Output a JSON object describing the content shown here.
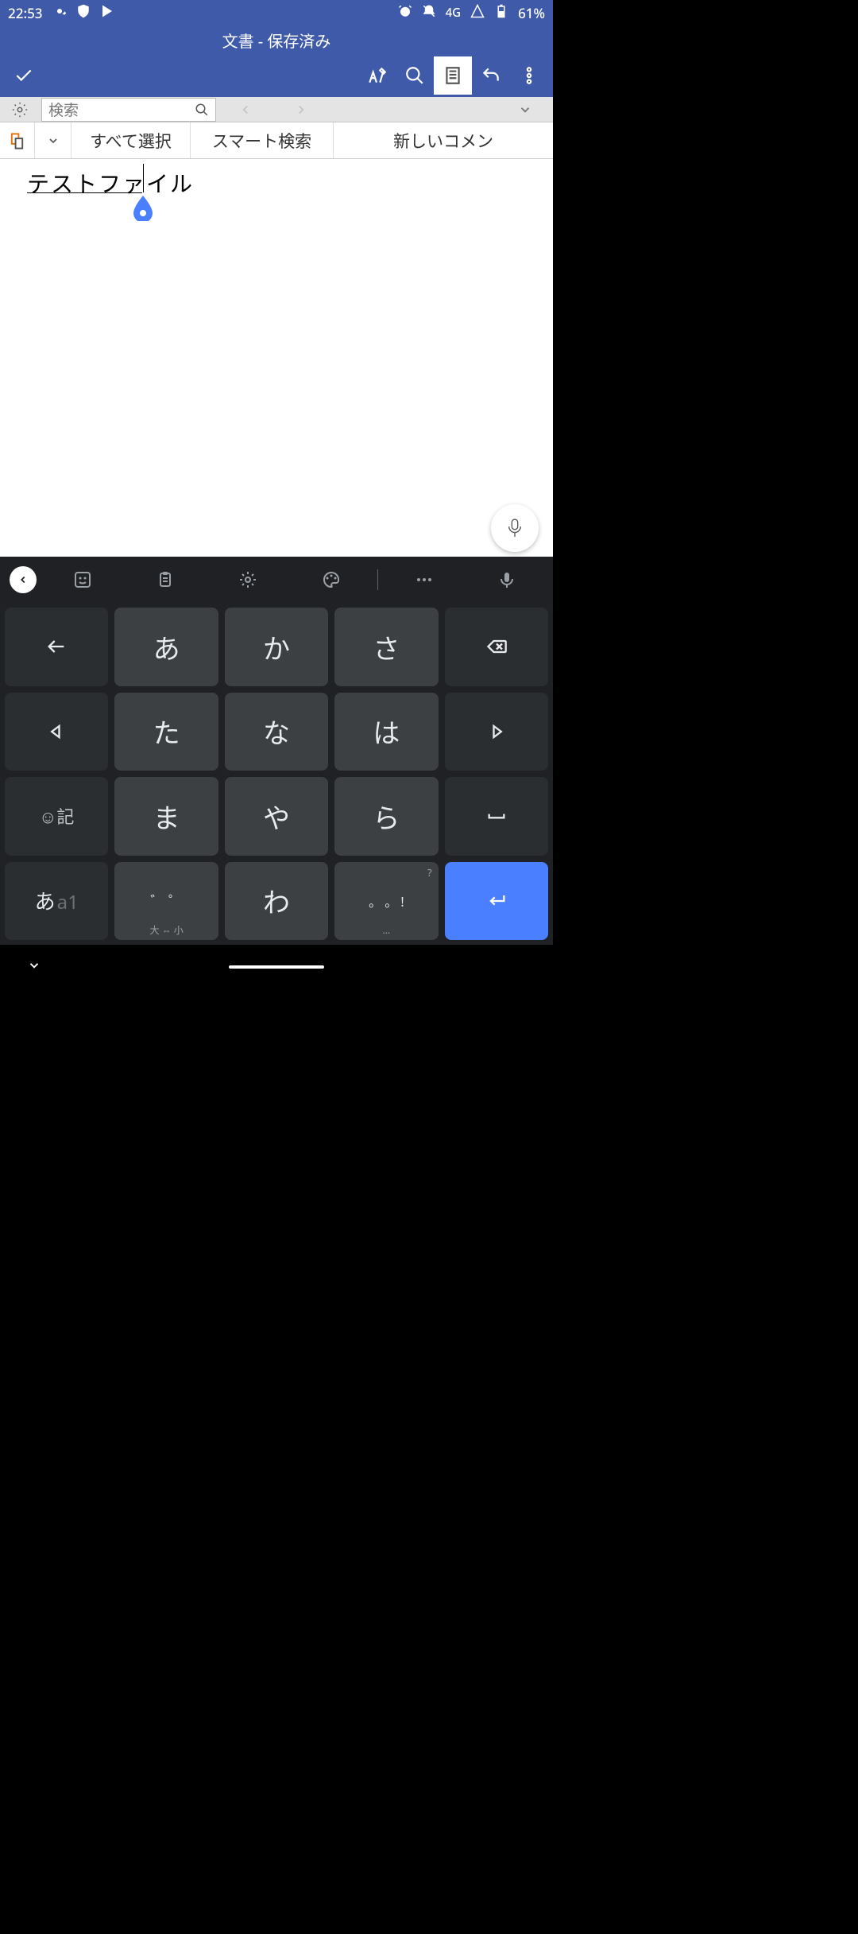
{
  "status": {
    "time": "22:53",
    "network": "4G",
    "battery": "61%"
  },
  "header": {
    "title": "文書 - 保存済み"
  },
  "subbar": {
    "search_placeholder": "検索"
  },
  "ctx": {
    "select_all": "すべて選択",
    "smart_search": "スマート検索",
    "new_comment": "新しいコメン"
  },
  "doc": {
    "text": "テストファイル"
  },
  "keys": {
    "r1": {
      "a": "あ",
      "ka": "か",
      "sa": "さ"
    },
    "r2": {
      "ta": "た",
      "na": "な",
      "ha": "は"
    },
    "r3": {
      "sym": "☺記",
      "ma": "ま",
      "ya": "や",
      "ra": "ら"
    },
    "r4": {
      "mode_jp": "あ",
      "mode_en": "a1",
      "size": "゛  ゜",
      "size_sub": "大 ⇔ 小",
      "wa": "わ",
      "punct_hint": "?",
      "punct": "。 。 !",
      "punct_sub": "…"
    }
  }
}
